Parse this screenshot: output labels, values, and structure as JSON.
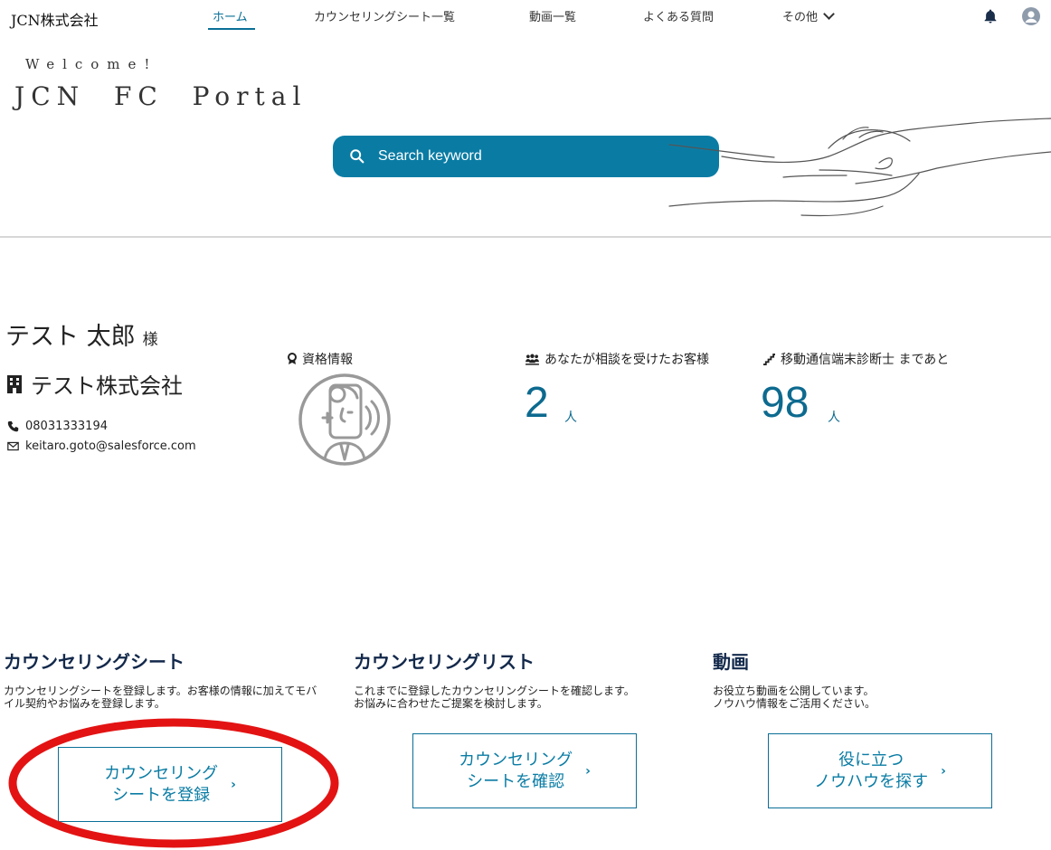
{
  "nav": {
    "brand": "JCN株式会社",
    "items": [
      {
        "label": "ホーム",
        "active": true
      },
      {
        "label": "カウンセリングシート一覧"
      },
      {
        "label": "動画一覧"
      },
      {
        "label": "よくある質問"
      },
      {
        "label": "その他"
      }
    ],
    "icons": [
      "bell-icon",
      "avatar-icon",
      "chevron-down-icon"
    ]
  },
  "hero": {
    "welcome": "Welcome!",
    "portal_title": "JCN  FC  Portal",
    "search_placeholder": "Search keyword"
  },
  "profile": {
    "name": "テスト 太郎",
    "honorific": "様",
    "company": "テスト株式会社",
    "phone": "08031333194",
    "email": "keitaro.goto@salesforce.com"
  },
  "stats": {
    "qualification_label": "資格情報",
    "consulted_label": "あなたが相談を受けたお客様",
    "consulted_value": "2",
    "consulted_unit": "人",
    "remaining_label": "移動通信端末診断士 まであと",
    "remaining_value": "98",
    "remaining_unit": "人"
  },
  "cards": [
    {
      "title": "カウンセリングシート",
      "desc": "カウンセリングシートを登録します。お客様の情報に加えてモバイル契約やお悩みを登録します。",
      "button": "カウンセリング\nシートを登録",
      "arrow": "›"
    },
    {
      "title": "カウンセリングリスト",
      "desc": "これまでに登録したカウンセリングシートを確認します。\nお悩みに合わせたご提案を検討します。",
      "button": "カウンセリング\nシートを確認",
      "arrow": "›"
    },
    {
      "title": "動画",
      "desc": "お役立ち動画を公開しています。\nノウハウ情報をご活用ください。",
      "button": "役に立つ\nノウハウを探す",
      "arrow": "›"
    }
  ],
  "colors": {
    "accent": "#0a7ca4",
    "heading": "#13294b",
    "highlight": "#e31313"
  }
}
